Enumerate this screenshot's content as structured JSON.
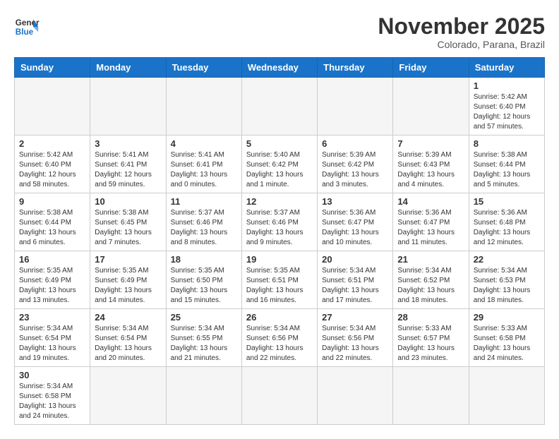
{
  "header": {
    "logo_line1": "General",
    "logo_line2": "Blue",
    "title": "November 2025",
    "subtitle": "Colorado, Parana, Brazil"
  },
  "weekdays": [
    "Sunday",
    "Monday",
    "Tuesday",
    "Wednesday",
    "Thursday",
    "Friday",
    "Saturday"
  ],
  "days": [
    {
      "num": "",
      "info": ""
    },
    {
      "num": "",
      "info": ""
    },
    {
      "num": "",
      "info": ""
    },
    {
      "num": "",
      "info": ""
    },
    {
      "num": "",
      "info": ""
    },
    {
      "num": "",
      "info": ""
    },
    {
      "num": "1",
      "info": "Sunrise: 5:42 AM\nSunset: 6:40 PM\nDaylight: 12 hours\nand 57 minutes."
    },
    {
      "num": "2",
      "info": "Sunrise: 5:42 AM\nSunset: 6:40 PM\nDaylight: 12 hours\nand 58 minutes."
    },
    {
      "num": "3",
      "info": "Sunrise: 5:41 AM\nSunset: 6:41 PM\nDaylight: 12 hours\nand 59 minutes."
    },
    {
      "num": "4",
      "info": "Sunrise: 5:41 AM\nSunset: 6:41 PM\nDaylight: 13 hours\nand 0 minutes."
    },
    {
      "num": "5",
      "info": "Sunrise: 5:40 AM\nSunset: 6:42 PM\nDaylight: 13 hours\nand 1 minute."
    },
    {
      "num": "6",
      "info": "Sunrise: 5:39 AM\nSunset: 6:42 PM\nDaylight: 13 hours\nand 3 minutes."
    },
    {
      "num": "7",
      "info": "Sunrise: 5:39 AM\nSunset: 6:43 PM\nDaylight: 13 hours\nand 4 minutes."
    },
    {
      "num": "8",
      "info": "Sunrise: 5:38 AM\nSunset: 6:44 PM\nDaylight: 13 hours\nand 5 minutes."
    },
    {
      "num": "9",
      "info": "Sunrise: 5:38 AM\nSunset: 6:44 PM\nDaylight: 13 hours\nand 6 minutes."
    },
    {
      "num": "10",
      "info": "Sunrise: 5:38 AM\nSunset: 6:45 PM\nDaylight: 13 hours\nand 7 minutes."
    },
    {
      "num": "11",
      "info": "Sunrise: 5:37 AM\nSunset: 6:46 PM\nDaylight: 13 hours\nand 8 minutes."
    },
    {
      "num": "12",
      "info": "Sunrise: 5:37 AM\nSunset: 6:46 PM\nDaylight: 13 hours\nand 9 minutes."
    },
    {
      "num": "13",
      "info": "Sunrise: 5:36 AM\nSunset: 6:47 PM\nDaylight: 13 hours\nand 10 minutes."
    },
    {
      "num": "14",
      "info": "Sunrise: 5:36 AM\nSunset: 6:47 PM\nDaylight: 13 hours\nand 11 minutes."
    },
    {
      "num": "15",
      "info": "Sunrise: 5:36 AM\nSunset: 6:48 PM\nDaylight: 13 hours\nand 12 minutes."
    },
    {
      "num": "16",
      "info": "Sunrise: 5:35 AM\nSunset: 6:49 PM\nDaylight: 13 hours\nand 13 minutes."
    },
    {
      "num": "17",
      "info": "Sunrise: 5:35 AM\nSunset: 6:49 PM\nDaylight: 13 hours\nand 14 minutes."
    },
    {
      "num": "18",
      "info": "Sunrise: 5:35 AM\nSunset: 6:50 PM\nDaylight: 13 hours\nand 15 minutes."
    },
    {
      "num": "19",
      "info": "Sunrise: 5:35 AM\nSunset: 6:51 PM\nDaylight: 13 hours\nand 16 minutes."
    },
    {
      "num": "20",
      "info": "Sunrise: 5:34 AM\nSunset: 6:51 PM\nDaylight: 13 hours\nand 17 minutes."
    },
    {
      "num": "21",
      "info": "Sunrise: 5:34 AM\nSunset: 6:52 PM\nDaylight: 13 hours\nand 18 minutes."
    },
    {
      "num": "22",
      "info": "Sunrise: 5:34 AM\nSunset: 6:53 PM\nDaylight: 13 hours\nand 18 minutes."
    },
    {
      "num": "23",
      "info": "Sunrise: 5:34 AM\nSunset: 6:54 PM\nDaylight: 13 hours\nand 19 minutes."
    },
    {
      "num": "24",
      "info": "Sunrise: 5:34 AM\nSunset: 6:54 PM\nDaylight: 13 hours\nand 20 minutes."
    },
    {
      "num": "25",
      "info": "Sunrise: 5:34 AM\nSunset: 6:55 PM\nDaylight: 13 hours\nand 21 minutes."
    },
    {
      "num": "26",
      "info": "Sunrise: 5:34 AM\nSunset: 6:56 PM\nDaylight: 13 hours\nand 22 minutes."
    },
    {
      "num": "27",
      "info": "Sunrise: 5:34 AM\nSunset: 6:56 PM\nDaylight: 13 hours\nand 22 minutes."
    },
    {
      "num": "28",
      "info": "Sunrise: 5:33 AM\nSunset: 6:57 PM\nDaylight: 13 hours\nand 23 minutes."
    },
    {
      "num": "29",
      "info": "Sunrise: 5:33 AM\nSunset: 6:58 PM\nDaylight: 13 hours\nand 24 minutes."
    },
    {
      "num": "30",
      "info": "Sunrise: 5:34 AM\nSunset: 6:58 PM\nDaylight: 13 hours\nand 24 minutes."
    },
    {
      "num": "",
      "info": ""
    },
    {
      "num": "",
      "info": ""
    },
    {
      "num": "",
      "info": ""
    },
    {
      "num": "",
      "info": ""
    },
    {
      "num": "",
      "info": ""
    },
    {
      "num": "",
      "info": ""
    }
  ]
}
